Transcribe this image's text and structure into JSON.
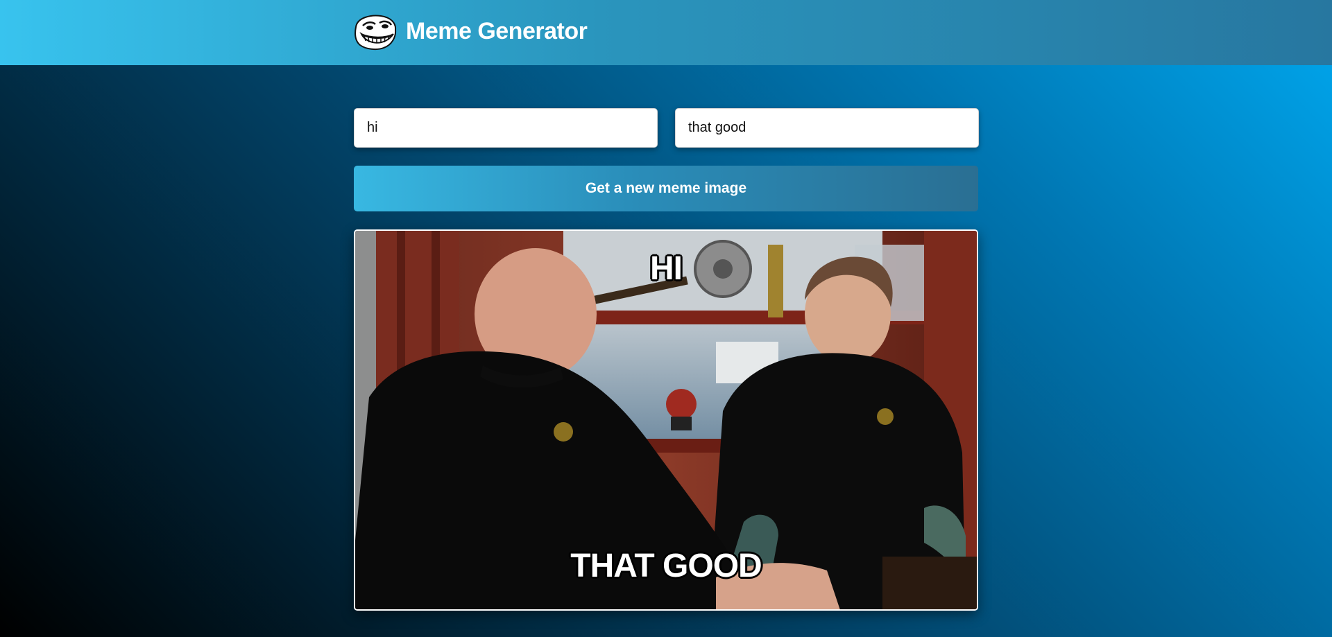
{
  "header": {
    "title": "Meme Generator",
    "logo_icon": "troll-face-icon"
  },
  "form": {
    "top_text_value": "hi",
    "bottom_text_value": "that good",
    "submit_label": "Get a new meme image"
  },
  "meme": {
    "top_text": "HI",
    "bottom_text": "THAT GOOD",
    "image_icon": "pawn-shop-photo"
  },
  "colors": {
    "header_start": "#38c3ee",
    "header_end": "#2777a0",
    "background_dark": "#000000",
    "background_light": "#00a8ef",
    "text": "#ffffff"
  }
}
